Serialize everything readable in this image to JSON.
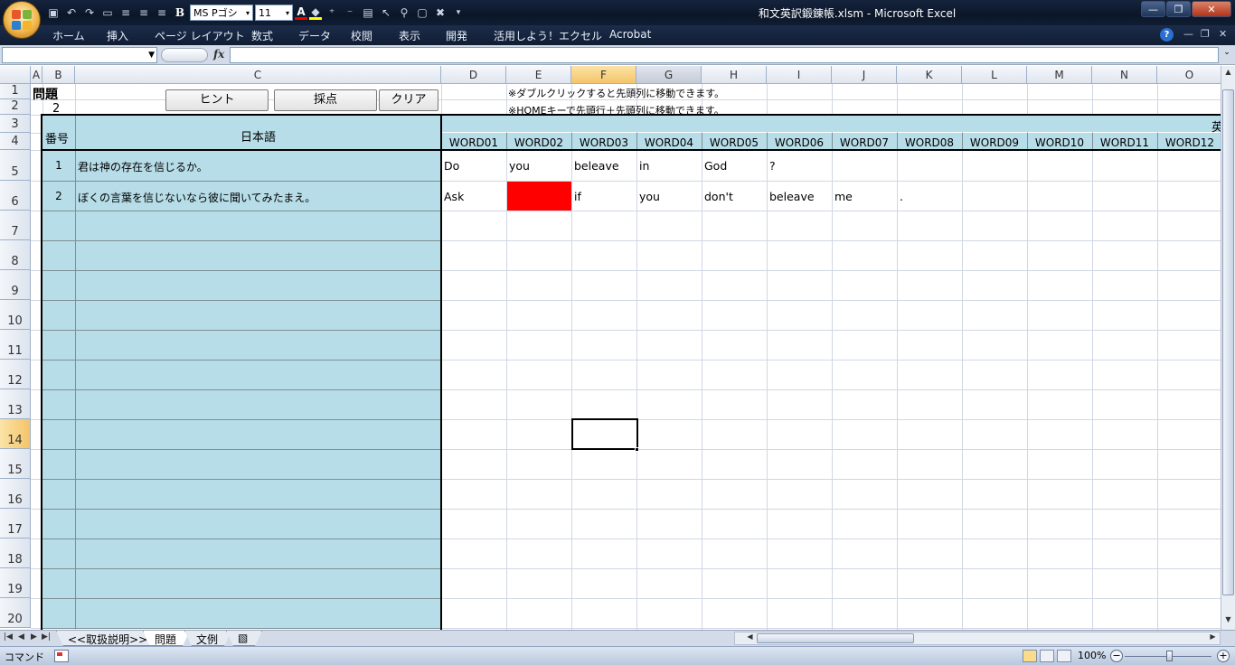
{
  "window": {
    "title": "和文英訳鍛錬帳.xlsm - Microsoft Excel",
    "minimize": "—",
    "restore": "❐",
    "close": "✕"
  },
  "qat": {
    "font_name": "MS Pゴシ",
    "font_size": "11",
    "bold": "B"
  },
  "ribbon": {
    "tabs": [
      "ホーム",
      "挿入",
      "ページ レイアウト",
      "数式",
      "データ",
      "校閲",
      "表示",
      "開発",
      "活用しよう！エクセル",
      "Acrobat"
    ],
    "help": "?"
  },
  "formula_bar": {
    "name_box": "",
    "fx": "fx",
    "formula": ""
  },
  "columns": [
    "A",
    "B",
    "C",
    "D",
    "E",
    "F",
    "G",
    "H",
    "I",
    "J",
    "K",
    "L",
    "M",
    "N",
    "O"
  ],
  "rows": [
    "1",
    "2",
    "3",
    "4",
    "5",
    "6",
    "7",
    "8",
    "9",
    "10",
    "11",
    "12",
    "13",
    "14",
    "15",
    "16",
    "17",
    "18",
    "19",
    "20"
  ],
  "sheet": {
    "problem_label": "問題",
    "problem_number": "2",
    "buttons": {
      "hint": "ヒント",
      "score": "採点",
      "clear": "クリア"
    },
    "note1": "※ダブルクリックすると先頭列に移動できます。",
    "note2": "※HOMEキーで先頭行＋先頭列に移動できます。",
    "header_no": "番号",
    "header_japanese": "日本語",
    "header_english_fragment": "英",
    "word_headers": [
      "WORD01",
      "WORD02",
      "WORD03",
      "WORD04",
      "WORD05",
      "WORD06",
      "WORD07",
      "WORD08",
      "WORD09",
      "WORD10",
      "WORD11",
      "WORD12"
    ],
    "items": [
      {
        "no": "1",
        "japanese": "君は神の存在を信じるか。",
        "words": [
          "Do",
          "you",
          "beleave",
          "in",
          "God",
          "?",
          "",
          "",
          "",
          "",
          "",
          ""
        ]
      },
      {
        "no": "2",
        "japanese": "ぼくの言葉を信じないなら彼に聞いてみたまえ。",
        "words": [
          "Ask",
          "",
          "if",
          "you",
          "don't",
          "beleave",
          "me",
          ".",
          "",
          "",
          "",
          ""
        ]
      }
    ],
    "highlight_color": "#ff0000",
    "fill_color": "#b7dde8"
  },
  "sheet_tabs": [
    "<<取扱説明>>",
    "問題",
    "文例"
  ],
  "active_sheet_tab": "問題",
  "status": {
    "mode": "コマンド",
    "zoom": "100%",
    "zoom_out": "−",
    "zoom_in": "+"
  }
}
